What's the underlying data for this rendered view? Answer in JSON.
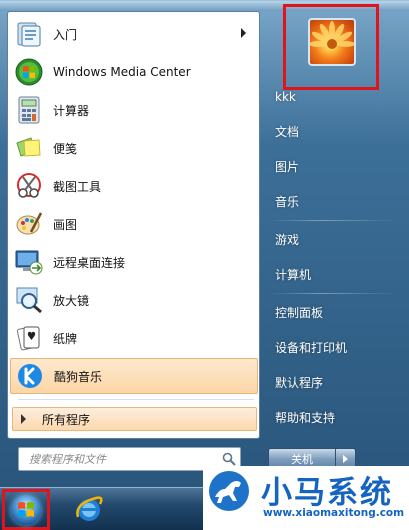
{
  "start_menu": {
    "pinned_items": [
      {
        "label": "入门",
        "icon": "getting-started-icon",
        "has_submenu": true
      },
      {
        "label": "Windows Media Center",
        "icon": "windows-media-center-icon",
        "has_submenu": false
      },
      {
        "label": "计算器",
        "icon": "calculator-icon",
        "has_submenu": false
      },
      {
        "label": "便笺",
        "icon": "sticky-notes-icon",
        "has_submenu": false
      },
      {
        "label": "截图工具",
        "icon": "snipping-tool-icon",
        "has_submenu": false
      },
      {
        "label": "画图",
        "icon": "paint-icon",
        "has_submenu": false
      },
      {
        "label": "远程桌面连接",
        "icon": "remote-desktop-icon",
        "has_submenu": false
      },
      {
        "label": "放大镜",
        "icon": "magnifier-icon",
        "has_submenu": false
      },
      {
        "label": "纸牌",
        "icon": "solitaire-icon",
        "has_submenu": false
      },
      {
        "label": "酷狗音乐",
        "icon": "kugou-music-icon",
        "has_submenu": false,
        "selected": true
      }
    ],
    "all_programs_label": "所有程序",
    "search": {
      "placeholder": "搜索程序和文件"
    },
    "right_links": [
      {
        "label": "kkk",
        "name": "user-name-link"
      },
      {
        "label": "文档",
        "name": "documents-link"
      },
      {
        "label": "图片",
        "name": "pictures-link"
      },
      {
        "label": "音乐",
        "name": "music-link"
      },
      {
        "label": "游戏",
        "name": "games-link"
      },
      {
        "label": "计算机",
        "name": "computer-link"
      },
      {
        "label": "控制面板",
        "name": "control-panel-link"
      },
      {
        "label": "设备和打印机",
        "name": "devices-printers-link"
      },
      {
        "label": "默认程序",
        "name": "default-programs-link"
      },
      {
        "label": "帮助和支持",
        "name": "help-support-link"
      }
    ],
    "shutdown_label": "关机"
  },
  "taskbar": {
    "start_button": "windows-start-orb-icon",
    "pinned": [
      "internet-explorer-icon"
    ]
  },
  "watermark": {
    "title": "小马系统",
    "url": "www.xiaomaxitong.com"
  },
  "colors": {
    "highlight_box": "#e0141c",
    "selected_item": "#fbd6a6",
    "watermark_blue": "#1565c0"
  }
}
